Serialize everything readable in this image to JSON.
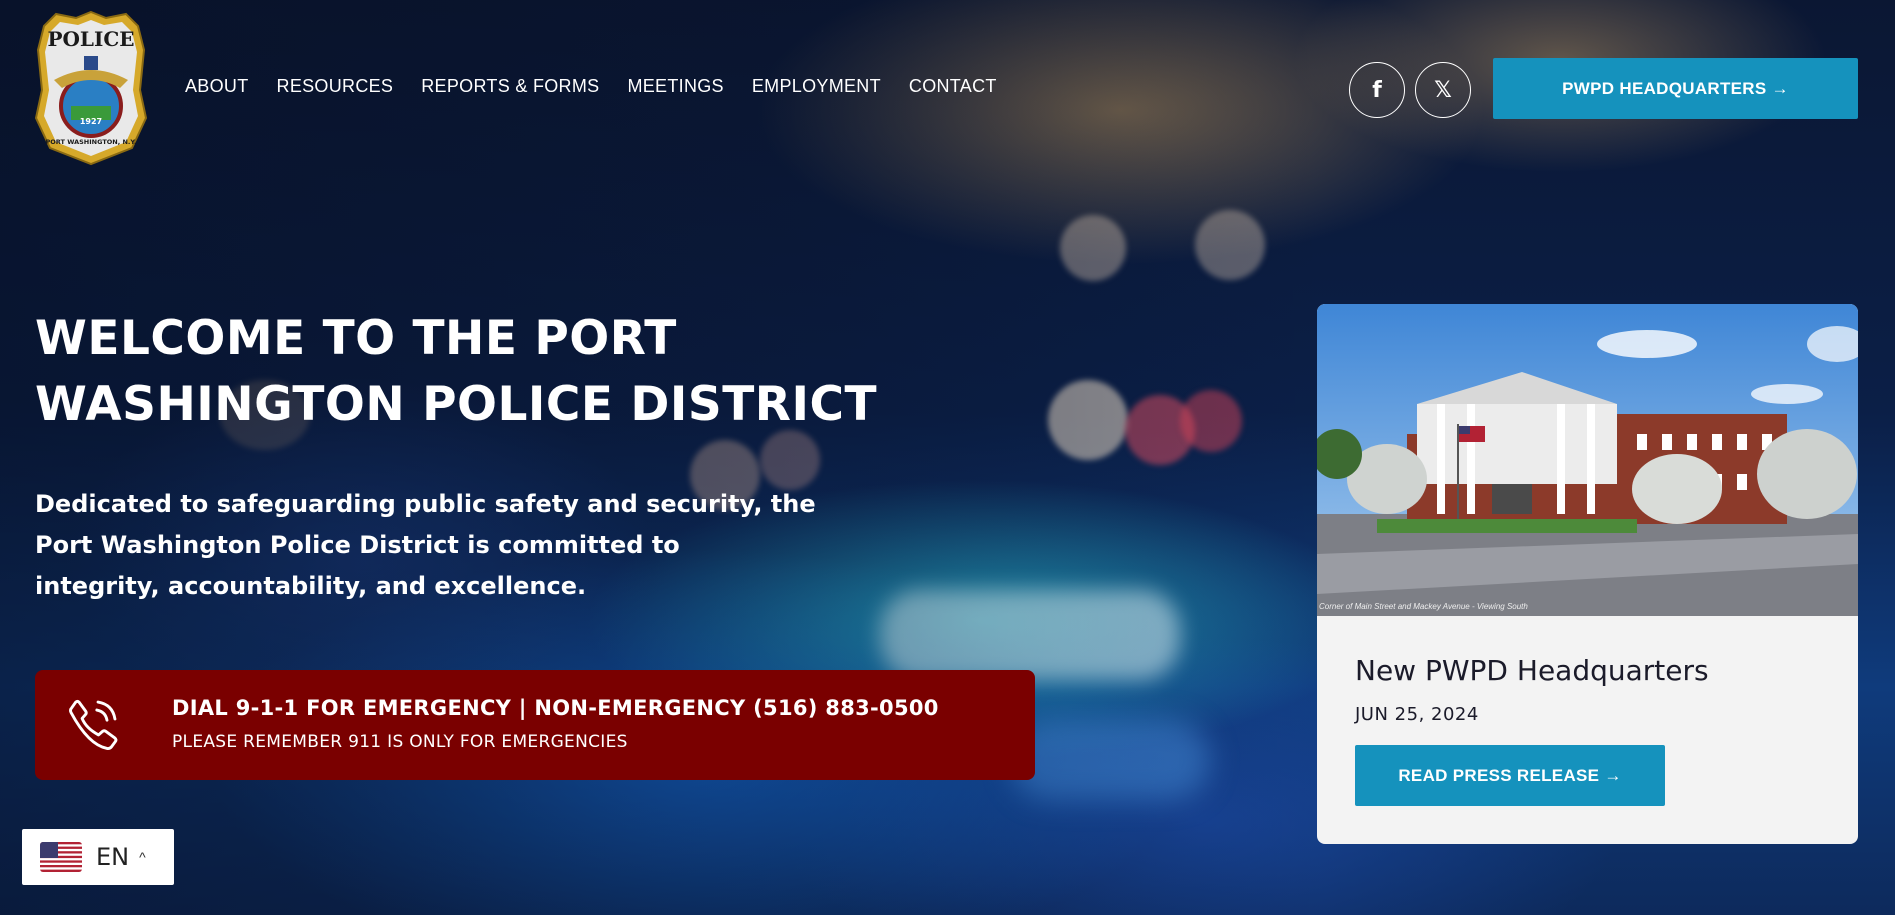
{
  "header": {
    "logo_top_text": "POLICE",
    "logo_year": "1927",
    "logo_bottom_text": "PORT WASHINGTON, N.Y.",
    "nav_items": [
      "ABOUT",
      "RESOURCES",
      "REPORTS & FORMS",
      "MEETINGS",
      "EMPLOYMENT",
      "CONTACT"
    ],
    "social": [
      {
        "icon": "facebook-icon",
        "glyph": "f"
      },
      {
        "icon": "x-twitter-icon",
        "glyph": "𝕏"
      }
    ],
    "hq_button_label": "PWPD HEADQUARTERS →"
  },
  "hero": {
    "title_line1": "WELCOME TO THE PORT",
    "title_line2": "WASHINGTON POLICE DISTRICT",
    "description_line1": "Dedicated to safeguarding public safety and security, the",
    "description_line2": "Port Washington Police District is committed to",
    "description_line3": "integrity, accountability, and excellence."
  },
  "emergency": {
    "headline": "DIAL 9-1-1 FOR EMERGENCY | NON-EMERGENCY (516) 883-0500",
    "subline": "PLEASE REMEMBER 911 IS ONLY FOR EMERGENCIES",
    "icon": "phone-icon"
  },
  "news_card": {
    "image_caption": "Corner of Main Street and Mackey Avenue - Viewing South",
    "title": "New PWPD Headquarters",
    "date": "JUN 25, 2024",
    "button_label": "READ PRESS RELEASE →"
  },
  "language": {
    "code": "EN",
    "chevron": "^"
  },
  "colors": {
    "accent_blue": "#1592bd",
    "emergency_red": "#7a0000",
    "card_bg": "#f3f3f3"
  }
}
